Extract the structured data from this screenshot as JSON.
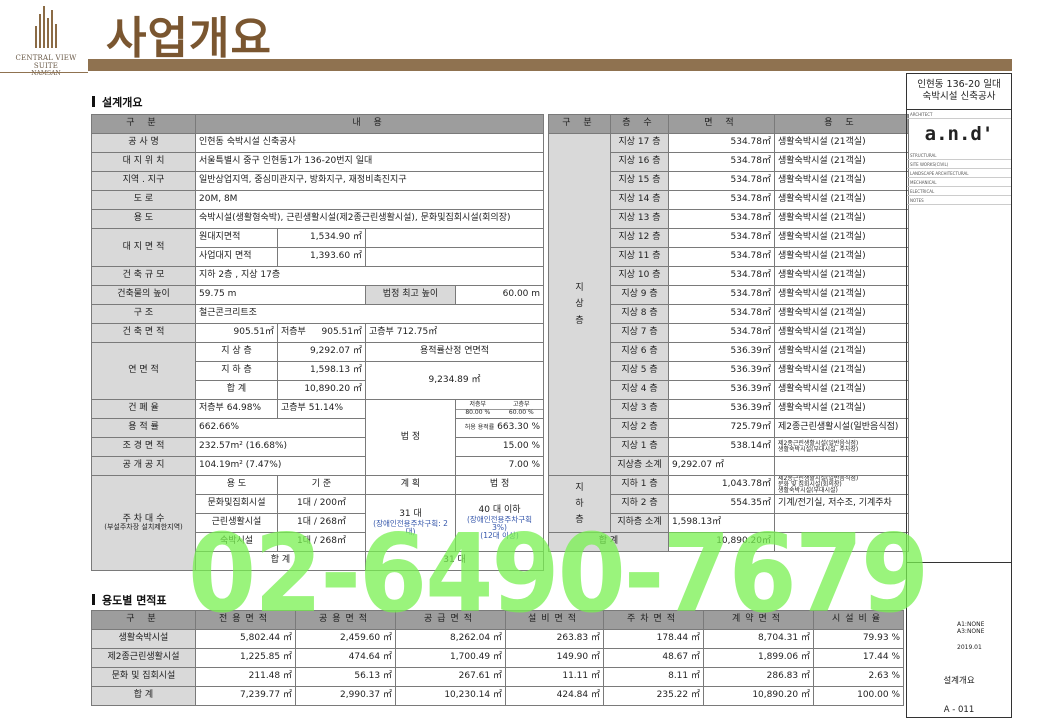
{
  "brand": {
    "line1": "CENTRAL VIEW SUITE",
    "line2": "NAMSAN"
  },
  "title": "사업개요",
  "section1": "설계개요",
  "section2": "용도별 면적표",
  "left": {
    "head": [
      "구 분",
      "내 용"
    ],
    "rows": [
      [
        "공 사 명",
        "인현동 숙박시설 신축공사"
      ],
      [
        "대 지 위 치",
        "서울특별시 중구 인현동1가 136-20번지 일대"
      ],
      [
        "지역 . 지구",
        "일반상업지역, 중심미관지구, 방화지구, 재정비촉진지구"
      ],
      [
        "도 로",
        "20M, 8M"
      ],
      [
        "용 도",
        "숙박시설(생활형숙박), 근린생활시설(제2종근린생활시설), 문화및집회시설(회의장)"
      ]
    ],
    "site": {
      "label": "대 지 면 적",
      "a": "원대지면적",
      "av": "1,534.90 ㎡",
      "b": "사업대지 면적",
      "bv": "1,393.60 ㎡"
    },
    "scale": {
      "label": "건 축 규 모",
      "v": "지하 2층 , 지상 17층"
    },
    "height": {
      "label": "건축물의 높이",
      "v": "59.75 m",
      "l2": "법정 최고 높이",
      "v2": "60.00 m"
    },
    "struct": {
      "label": "구 조",
      "v": "철근콘크리트조"
    },
    "bldg": {
      "label": "건 축 면 적",
      "v1": "905.51㎡",
      "l2": "저층부",
      "v2": "905.51㎡",
      "l3": "고층부",
      "v3": "712.75㎡"
    },
    "floor": {
      "label": "연 면 적",
      "a": "지 상 층",
      "av": "9,292.07 ㎡",
      "b": "지 하 층",
      "bv": "1,598.13 ㎡",
      "c": "합 계",
      "cv": "10,890.20 ㎡",
      "far_label": "용적률산정 연면적",
      "far_v": "9,234.89 ㎡"
    },
    "bcr": {
      "label": "건 폐 율",
      "l1": "저층부",
      "v1": "64.98%",
      "l2": "고층부",
      "v2": "51.14%",
      "legal": "법 정",
      "t1": "저층부",
      "t1v": "80.00 %",
      "t2": "고층부",
      "t2v": "60.00 %"
    },
    "far": {
      "label": "용 적 률",
      "v": "662.66%",
      "note": "허용 용적률",
      "nv": "663.30 %"
    },
    "land": {
      "label": "조 경 면 적",
      "v": "232.57m² (16.68%)",
      "legal": "15.00 %"
    },
    "open": {
      "label": "공 개 공 지",
      "v": "104.19m² (7.47%)",
      "legal": "7.00 %"
    },
    "parking": {
      "label": "주 차 대 수",
      "sub": "(부설주차장 설치제한지역)",
      "h1": "용 도",
      "h2": "기 준",
      "h3": "계 획",
      "h4": "법 정",
      "r1": [
        "문화및집회시설",
        "1대 / 200㎡"
      ],
      "r2": [
        "근린생활시설",
        "1대 / 268㎡"
      ],
      "r3": [
        "숙박시설",
        "1대 / 268㎡"
      ],
      "plan": "31 대",
      "plan_note": "(장애인전용주차구획: 2대)",
      "legal": "40 대 이하",
      "legal_note": "(장애인전용주차구획 3%)",
      "legal_note2": "(12대 이상)",
      "sum": "합 계",
      "sumv": "31 대"
    }
  },
  "right": {
    "head": [
      "구 분",
      "층 수",
      "면 적",
      "용 도"
    ],
    "above_label": "지 상 층",
    "below_label": "지 하 층",
    "floors": [
      [
        "지상 17 층",
        "534.78㎡",
        "생활숙박시설 (21객실)"
      ],
      [
        "지상 16 층",
        "534.78㎡",
        "생활숙박시설 (21객실)"
      ],
      [
        "지상 15 층",
        "534.78㎡",
        "생활숙박시설 (21객실)"
      ],
      [
        "지상 14 층",
        "534.78㎡",
        "생활숙박시설 (21객실)"
      ],
      [
        "지상 13 층",
        "534.78㎡",
        "생활숙박시설 (21객실)"
      ],
      [
        "지상 12 층",
        "534.78㎡",
        "생활숙박시설 (21객실)"
      ],
      [
        "지상 11 층",
        "534.78㎡",
        "생활숙박시설 (21객실)"
      ],
      [
        "지상 10 층",
        "534.78㎡",
        "생활숙박시설 (21객실)"
      ],
      [
        "지상 9 층",
        "534.78㎡",
        "생활숙박시설 (21객실)"
      ],
      [
        "지상 8 층",
        "534.78㎡",
        "생활숙박시설 (21객실)"
      ],
      [
        "지상 7 층",
        "534.78㎡",
        "생활숙박시설 (21객실)"
      ],
      [
        "지상 6 층",
        "536.39㎡",
        "생활숙박시설 (21객실)"
      ],
      [
        "지상 5 층",
        "536.39㎡",
        "생활숙박시설 (21객실)"
      ],
      [
        "지상 4 층",
        "536.39㎡",
        "생활숙박시설 (21객실)"
      ],
      [
        "지상 3 층",
        "536.39㎡",
        "생활숙박시설 (21객실)"
      ],
      [
        "지상 2 층",
        "725.79㎡",
        "제2종근린생활시설(일반음식점)"
      ]
    ],
    "f1": [
      "지상 1 층",
      "538.14㎡",
      "제2종근린생활시설(일반음식점)",
      "생활숙박시설(부대시설, 주차장)"
    ],
    "above_sum": [
      "지상층 소계",
      "9,292.07 ㎡"
    ],
    "b1": [
      "지하 1 층",
      "1,043.78㎡",
      "제2종근린생활시설(일반음식점)",
      "문화 및 집회시설(회의장)",
      "생활숙박시설(부대시설)"
    ],
    "b2": [
      "지하 2 층",
      "554.35㎡",
      "기계/전기실, 저수조, 기계주차"
    ],
    "below_sum": [
      "지하층 소계",
      "1,598.13㎡"
    ],
    "total": [
      "합 계",
      "10,890.20㎡"
    ]
  },
  "area": {
    "head": [
      "구 분",
      "전용면적",
      "공용면적",
      "공급면적",
      "설비면적",
      "주차면적",
      "계약면적",
      "시설비율"
    ],
    "rows": [
      [
        "생활숙박시설",
        "5,802.44 ㎡",
        "2,459.60 ㎡",
        "8,262.04 ㎡",
        "263.83 ㎡",
        "178.44 ㎡",
        "8,704.31 ㎡",
        "79.93 %"
      ],
      [
        "제2종근린생활시설",
        "1,225.85 ㎡",
        "474.64 ㎡",
        "1,700.49 ㎡",
        "149.90 ㎡",
        "48.67 ㎡",
        "1,899.06 ㎡",
        "17.44 %"
      ],
      [
        "문화 및 집회시설",
        "211.48 ㎡",
        "56.13 ㎡",
        "267.61 ㎡",
        "11.11 ㎡",
        "8.11 ㎡",
        "286.83 ㎡",
        "2.63 %"
      ],
      [
        "합 계",
        "7,239.77 ㎡",
        "2,990.37 ㎡",
        "10,230.14 ㎡",
        "424.84 ㎡",
        "235.22 ㎡",
        "10,890.20 ㎡",
        "100.00 %"
      ]
    ]
  },
  "panel": {
    "project": "인현동 136-20 일대",
    "project2": "숙박시설 신축공사",
    "logo": "a.n.d'",
    "sheet_title": "설계개요",
    "sheet_no": "A - 011",
    "date": "2019.01",
    "scale": "A1:NONE",
    "scale2": "A3:NONE",
    "labels": [
      "ARCHITECT",
      "STRUCTURAL",
      "SITE WORKS(CIVIL)",
      "LANDSCAPE ARCHITECTURAL",
      "MECHANICAL",
      "ELECTRICAL",
      "NOTES"
    ]
  },
  "watermark": "02-6490-7679"
}
